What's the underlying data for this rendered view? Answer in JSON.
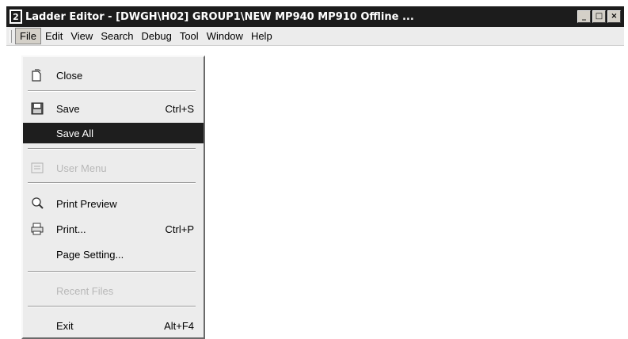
{
  "window": {
    "title": "Ladder Editor - [DWGH\\H02]   GROUP1\\NEW  MP940  MP910    Offline  ...",
    "minimize": "_",
    "maximize": "□",
    "close": "×"
  },
  "menubar": {
    "items": [
      {
        "label": "File"
      },
      {
        "label": "Edit"
      },
      {
        "label": "View"
      },
      {
        "label": "Search"
      },
      {
        "label": "Debug"
      },
      {
        "label": "Tool"
      },
      {
        "label": "Window"
      },
      {
        "label": "Help"
      }
    ]
  },
  "file_menu": {
    "close": {
      "label": "Close",
      "icon": "close-file-icon"
    },
    "save": {
      "label": "Save",
      "shortcut": "Ctrl+S",
      "icon": "floppy-icon"
    },
    "save_all": {
      "label": "Save All"
    },
    "user_menu": {
      "label": "User Menu",
      "disabled": true,
      "icon": "user-menu-icon"
    },
    "print_preview": {
      "label": "Print Preview",
      "icon": "print-preview-icon"
    },
    "print": {
      "label": "Print...",
      "shortcut": "Ctrl+P",
      "icon": "printer-icon"
    },
    "page_setting": {
      "label": "Page Setting..."
    },
    "recent_files": {
      "label": "Recent Files",
      "disabled": true
    },
    "exit": {
      "label": "Exit",
      "shortcut": "Alt+F4"
    }
  },
  "colors": {
    "highlight": "#1e1e1e",
    "titlebar": "#1c1c1c",
    "menu_bg": "#ececec",
    "disabled_text": "#b8b8b8"
  }
}
